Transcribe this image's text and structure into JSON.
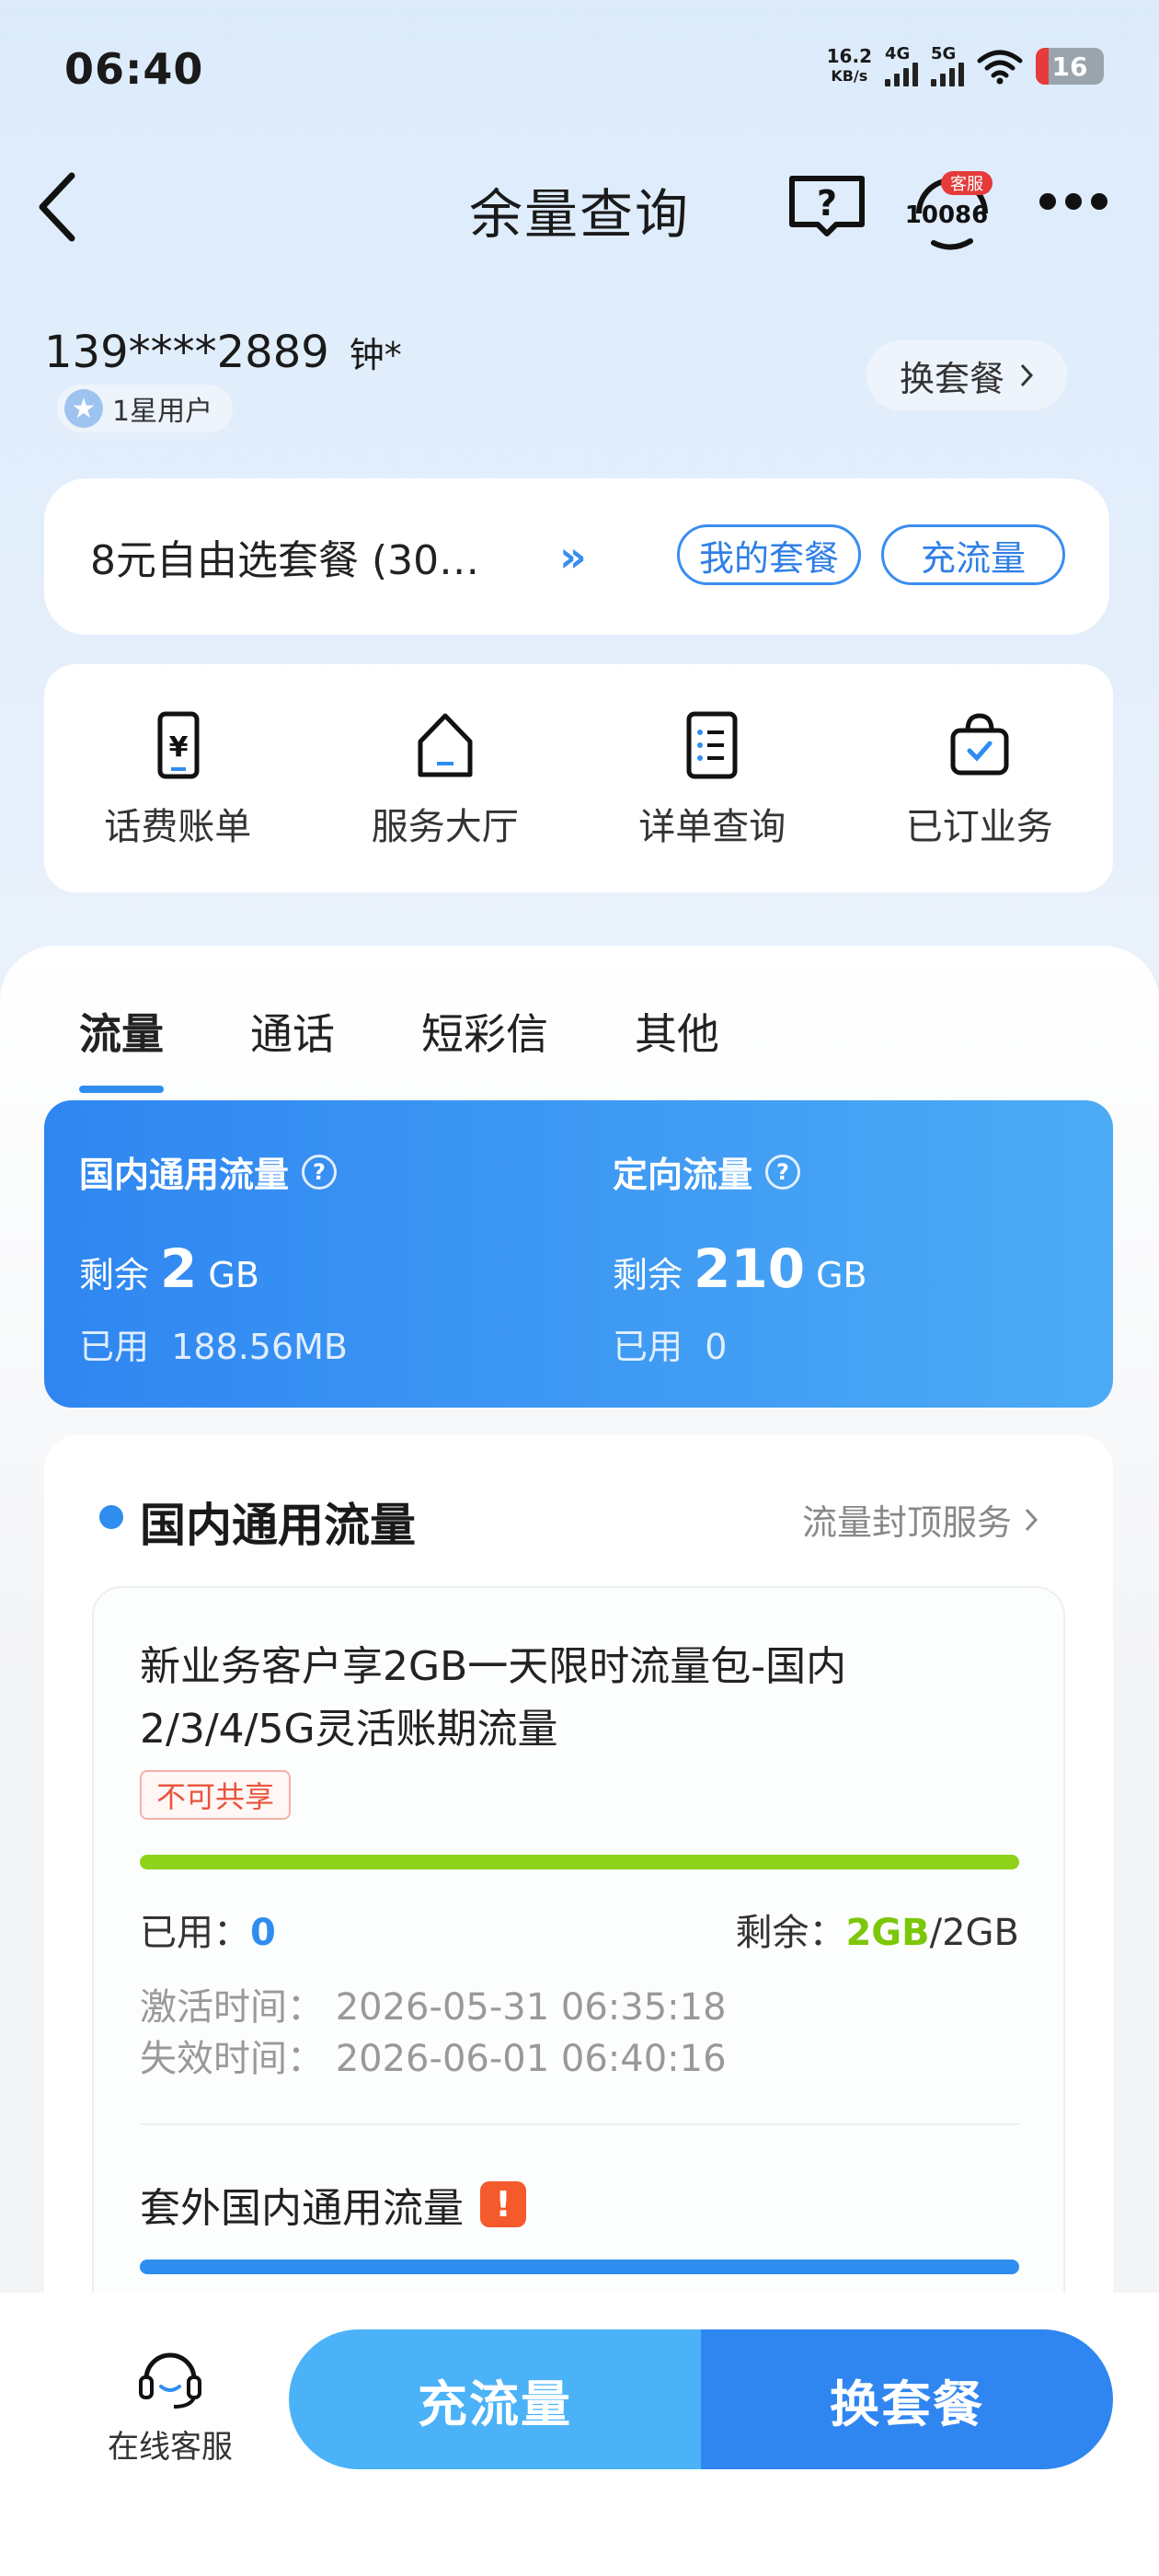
{
  "status_bar": {
    "time": "06:40",
    "net_speed_value": "16.2",
    "net_speed_unit": "KB/s",
    "sig1": "4G",
    "sig2": "5G",
    "battery": "16"
  },
  "nav": {
    "title": "余量查询",
    "cs_badge": "客服",
    "cs_number": "10086"
  },
  "user": {
    "phone": "139****2889",
    "name": "钟*",
    "level": "1星用户",
    "switch_label": "换套餐"
  },
  "plan": {
    "name": "8元自由选套餐 (30…",
    "my_plan": "我的套餐",
    "recharge": "充流量"
  },
  "quick_menu": [
    {
      "label": "话费账单",
      "icon": "bill-icon"
    },
    {
      "label": "服务大厅",
      "icon": "home-icon"
    },
    {
      "label": "详单查询",
      "icon": "list-icon"
    },
    {
      "label": "已订业务",
      "icon": "bag-icon"
    }
  ],
  "tabs": [
    "流量",
    "通话",
    "短彩信",
    "其他"
  ],
  "summary": {
    "left": {
      "title": "国内通用流量",
      "remain_label": "剩余",
      "remain_value": "2",
      "remain_unit": "GB",
      "used_label": "已用",
      "used_value": "188.56MB"
    },
    "right": {
      "title": "定向流量",
      "remain_label": "剩余",
      "remain_value": "210",
      "remain_unit": "GB",
      "used_label": "已用",
      "used_value": "0"
    }
  },
  "detail": {
    "title": "国内通用流量",
    "cap_service": "流量封顶服务",
    "package": {
      "name_line1": "新业务客户享2GB一天限时流量包-国内",
      "name_line2": "2/3/4/5G灵活账期流量",
      "tag": "不可共享",
      "used_fraction": 0,
      "used_label": "已用：",
      "used_value": "0",
      "remain_label": "剩余：",
      "remain_value": "2GB",
      "total": "/2GB",
      "activate": "激活时间：  2026-05-31 06:35:18",
      "expire": "失效时间：  2026-06-01 06:40:16"
    },
    "extra_title": "套外国内通用流量"
  },
  "bottom": {
    "online_service": "在线客服",
    "btn_recharge": "充流量",
    "btn_switch": "换套餐"
  },
  "colors": {
    "accent": "#2f8df0",
    "green": "#7cc70a",
    "warn": "#f55a2c"
  }
}
